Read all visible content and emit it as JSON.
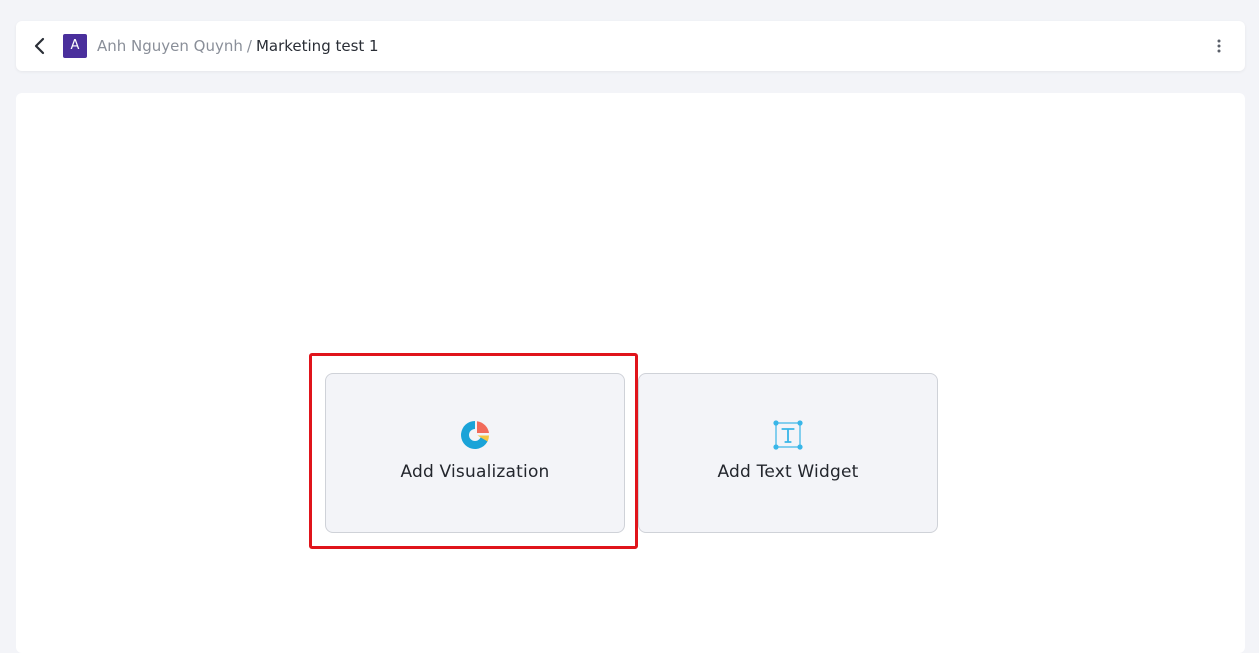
{
  "header": {
    "workspace_initial": "A",
    "owner_name": "Anh Nguyen Quynh",
    "separator": "/",
    "dashboard_title": "Marketing test 1"
  },
  "canvas": {
    "cards": [
      {
        "label": "Add Visualization",
        "icon": "pie-chart-icon"
      },
      {
        "label": "Add Text Widget",
        "icon": "text-box-icon"
      }
    ]
  },
  "colors": {
    "avatar_bg": "#4a2f9c",
    "highlight": "#e0141b",
    "viz_icon_blue": "#1aa3d8",
    "viz_icon_red": "#f26b5b",
    "viz_icon_yellow": "#f5c542",
    "text_icon_blue": "#38b6e8"
  }
}
